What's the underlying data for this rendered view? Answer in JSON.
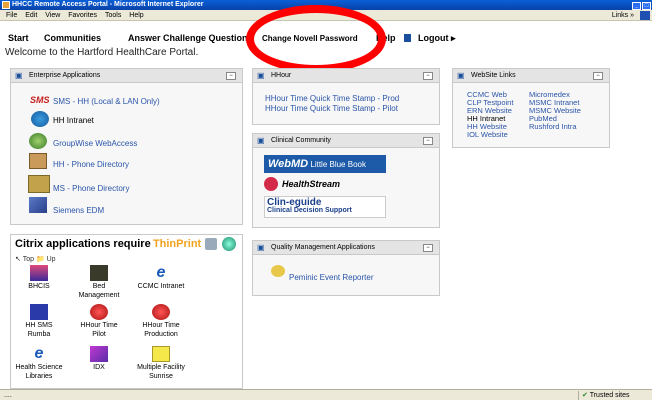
{
  "window": {
    "title": "HHCC Remote Access Portal - Microsoft Internet Explorer",
    "controls": [
      "_",
      "□"
    ]
  },
  "menu": [
    "File",
    "Edit",
    "View",
    "Favorites",
    "Tools",
    "Help"
  ],
  "links_label": "Links",
  "nav": {
    "start": "Start",
    "communities": "Communities",
    "answer": "Answer Challenge Questions",
    "change": "Change Novell Password",
    "help": "Help",
    "logout": "Logout"
  },
  "welcome": "Welcome to the Hartford HealthCare Portal.",
  "enterprise": {
    "title": "Enterprise Applications",
    "items": [
      "SMS - HH (Local & LAN Only)",
      "HH Intranet",
      "GroupWise WebAccess",
      "HH - Phone Directory",
      "MS - Phone Directory",
      "Siemens EDM"
    ],
    "sms_logo": "SMS"
  },
  "hhour": {
    "title": "HHour",
    "items": [
      "HHour Time Quick Time Stamp - Prod",
      "HHour Time Quick Time Stamp - Pilot"
    ]
  },
  "clinical": {
    "title": "Clinical Community",
    "webmd": "Little Blue Book",
    "webmd_logo": "WebMD",
    "healthstream": "HealthStream",
    "clin": "Clin-eguide",
    "clin_sub": "Clinical Decision Support"
  },
  "quality": {
    "title": "Quality Management Applications",
    "item": "Peminic Event Reporter"
  },
  "website": {
    "title": "WebSite Links",
    "col1": [
      "CCMC Web",
      "CLP Testpoint",
      "ERN Website",
      "HH Intranet",
      "HH Website",
      "IOL Website"
    ],
    "col2": [
      "Micromedex",
      "MSMC Intranet",
      "MSMC Website",
      "PubMed",
      "Rushford Intra"
    ]
  },
  "citrix": {
    "title": "Citrix applications require",
    "thinprint": "ThinPrint",
    "top": "Top",
    "up": "Up",
    "apps": [
      "BHCIS",
      "Bed Management",
      "CCMC Intranet",
      "HH SMS Rumba",
      "HHour Time Pilot",
      "HHour Time Production",
      "Health Science Libraries",
      "IDX",
      "Multiple Facility Sunrise"
    ]
  },
  "status": {
    "left": "....",
    "zone": "Trusted sites"
  }
}
